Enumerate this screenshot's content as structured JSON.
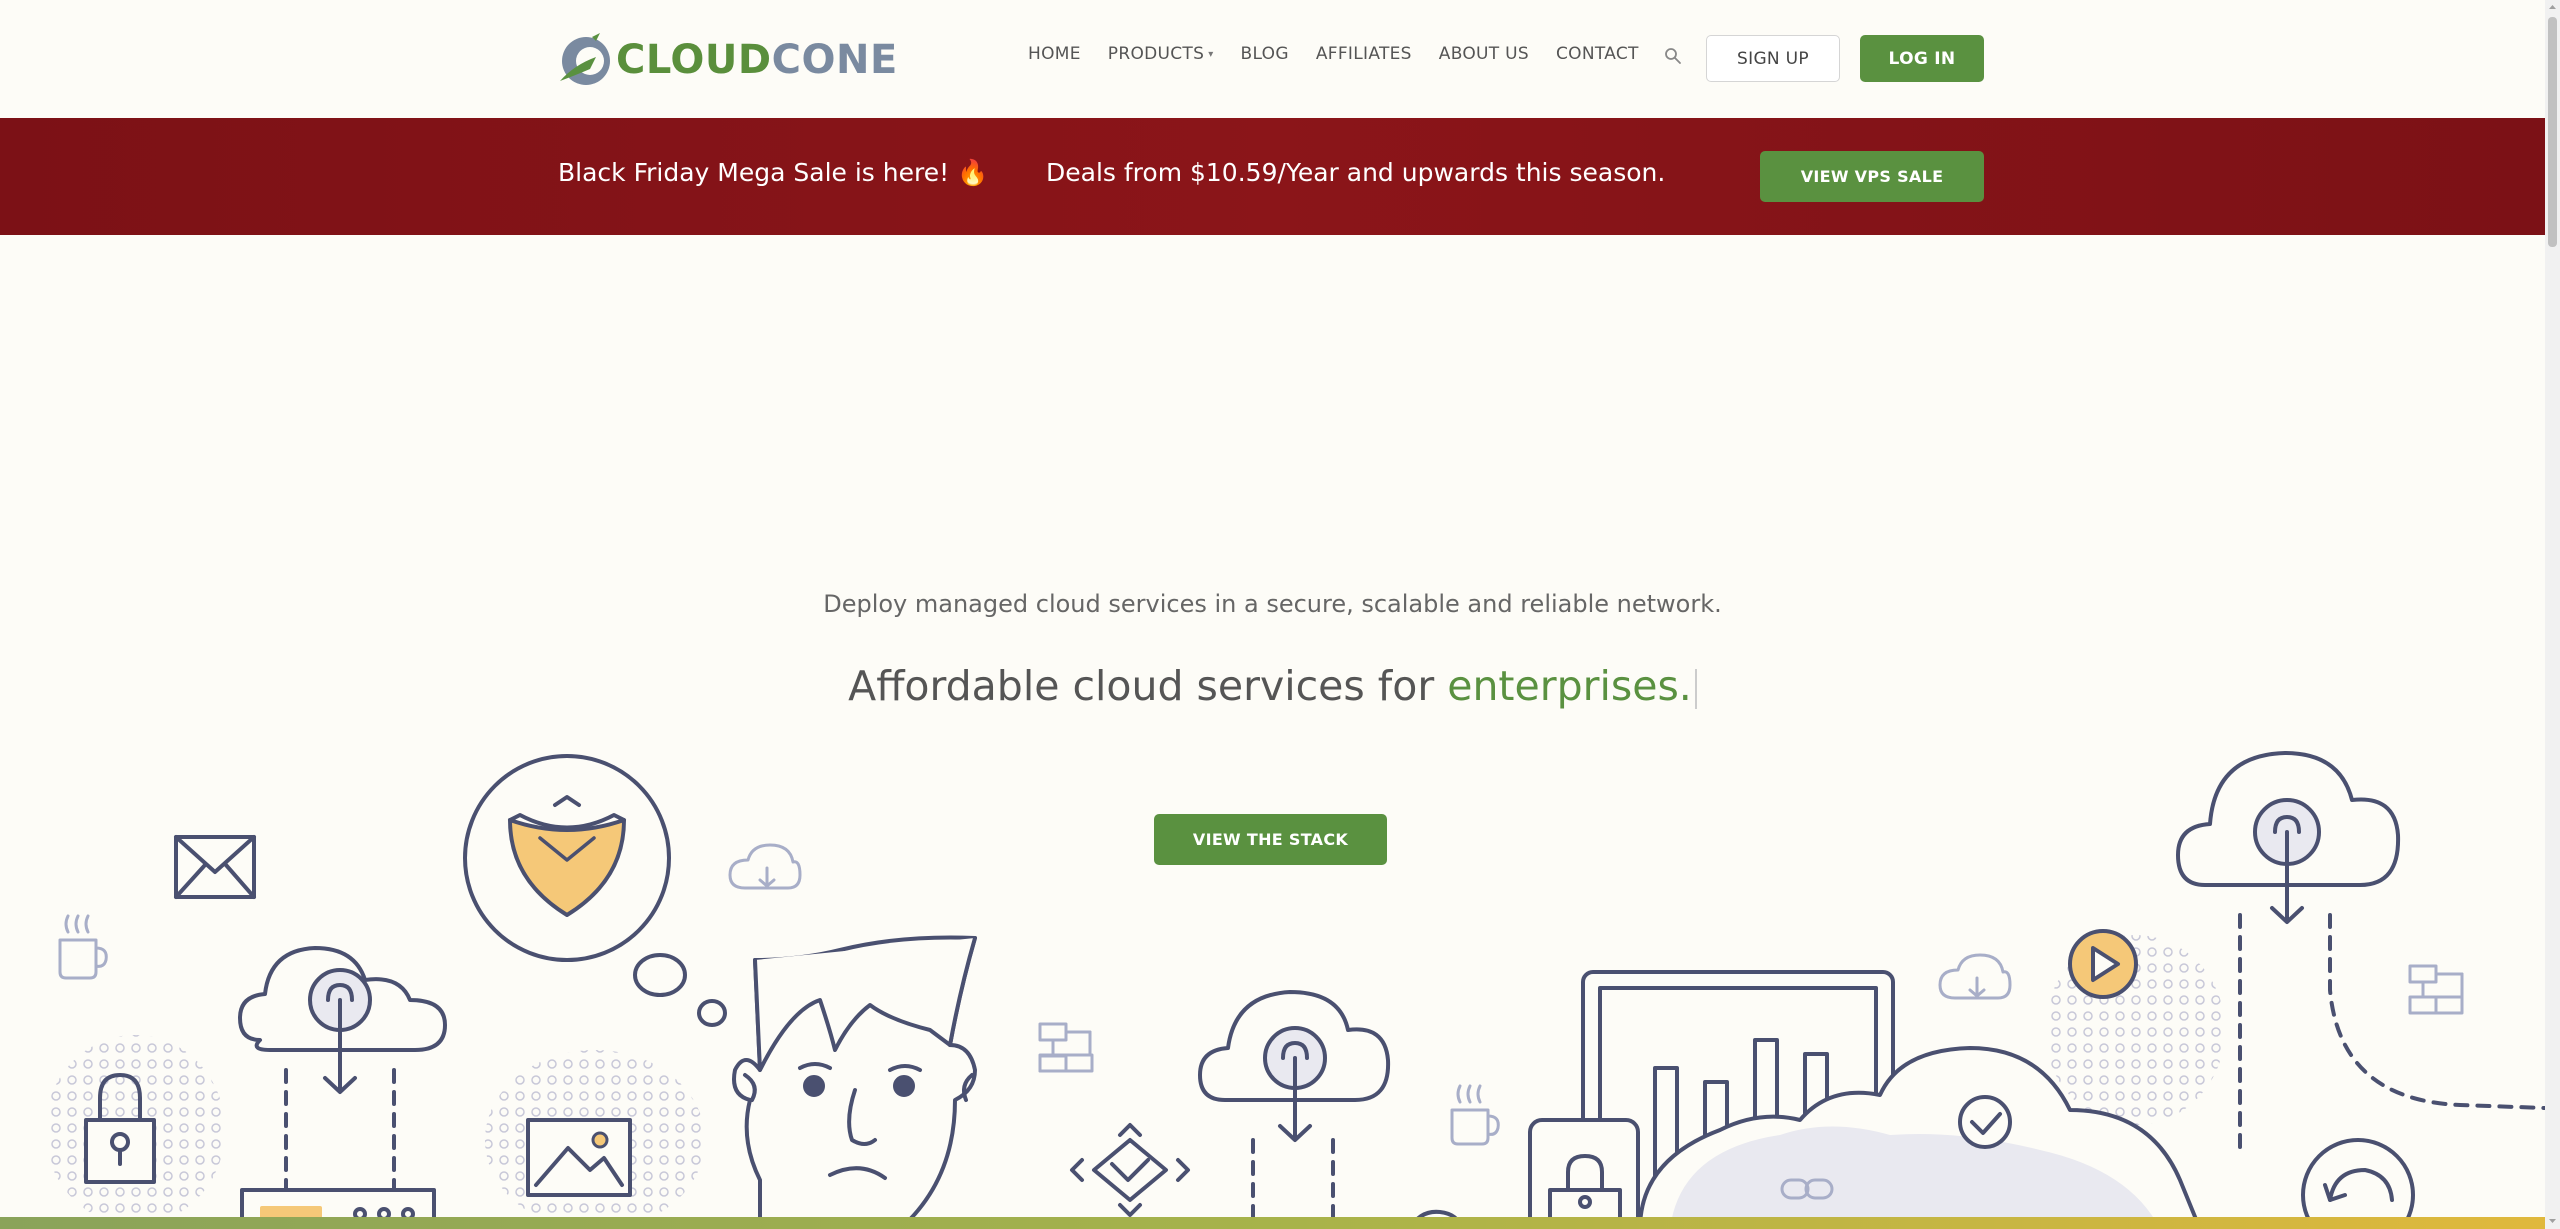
{
  "brand": {
    "cloud": "CLOUD",
    "cone": "CONE",
    "primary_color": "#5a9140",
    "promo_color": "#7c1116"
  },
  "nav": {
    "items": [
      "HOME",
      "PRODUCTS",
      "BLOG",
      "AFFILIATES",
      "ABOUT US",
      "CONTACT"
    ],
    "products_caret": "▾"
  },
  "header": {
    "signup": "SIGN UP",
    "login": "LOG IN"
  },
  "promo": {
    "left_text": "Black Friday Mega Sale is here! 🔥",
    "mid_text": "Deals from $10.59/Year and upwards this season.",
    "button": "VIEW VPS SALE"
  },
  "hero": {
    "subtitle": "Deploy managed cloud services in a secure, scalable and reliable network.",
    "title_prefix": "Affordable cloud services for ",
    "title_accent": "enterprises.",
    "button": "VIEW THE STACK"
  },
  "icons": {
    "search": "search-icon",
    "logo": "cloudcone-logo-icon"
  }
}
